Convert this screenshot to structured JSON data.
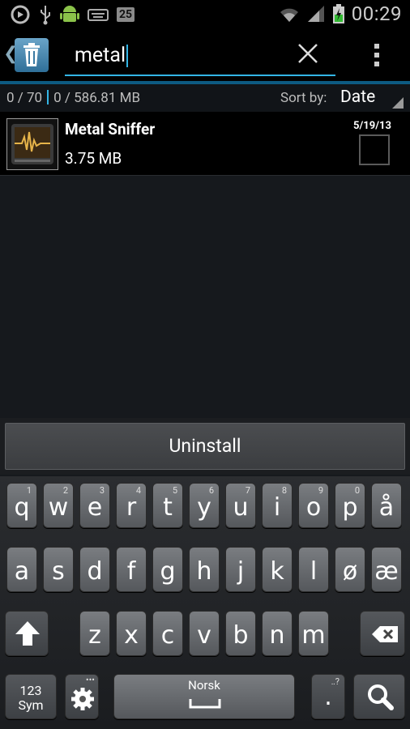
{
  "status_bar": {
    "icons": [
      "sync-icon",
      "usb-icon",
      "android-icon",
      "keyboard-icon"
    ],
    "notification_count": "25",
    "time": "00:29"
  },
  "action_bar": {
    "search_text": "metal",
    "colors": {
      "accent": "#33b5e5"
    }
  },
  "info_bar": {
    "count": "0 / 70",
    "size": "0 / 586.81 MB",
    "sort_label": "Sort by:",
    "sort_value": "Date"
  },
  "app_list": [
    {
      "name": "Metal Sniffer",
      "size": "3.75 MB",
      "date": "5/19/13",
      "checked": false
    }
  ],
  "uninstall_label": "Uninstall",
  "keyboard": {
    "row1": [
      {
        "ch": "q",
        "hint": "1"
      },
      {
        "ch": "w",
        "hint": "2"
      },
      {
        "ch": "e",
        "hint": "3"
      },
      {
        "ch": "r",
        "hint": "4"
      },
      {
        "ch": "t",
        "hint": "5"
      },
      {
        "ch": "y",
        "hint": "6"
      },
      {
        "ch": "u",
        "hint": "7"
      },
      {
        "ch": "i",
        "hint": "8"
      },
      {
        "ch": "o",
        "hint": "9"
      },
      {
        "ch": "p",
        "hint": "0"
      },
      {
        "ch": "å",
        "hint": ""
      }
    ],
    "row2": [
      {
        "ch": "a"
      },
      {
        "ch": "s"
      },
      {
        "ch": "d"
      },
      {
        "ch": "f"
      },
      {
        "ch": "g"
      },
      {
        "ch": "h"
      },
      {
        "ch": "j"
      },
      {
        "ch": "k"
      },
      {
        "ch": "l"
      },
      {
        "ch": "ø"
      },
      {
        "ch": "æ"
      }
    ],
    "row3": [
      {
        "ch": "z"
      },
      {
        "ch": "x"
      },
      {
        "ch": "c"
      },
      {
        "ch": "v"
      },
      {
        "ch": "b"
      },
      {
        "ch": "n"
      },
      {
        "ch": "m"
      }
    ],
    "sym_label_1": "123",
    "sym_label_2": "Sym",
    "space_label": "Norsk",
    "period": ".",
    "period_hint": "‥?"
  }
}
